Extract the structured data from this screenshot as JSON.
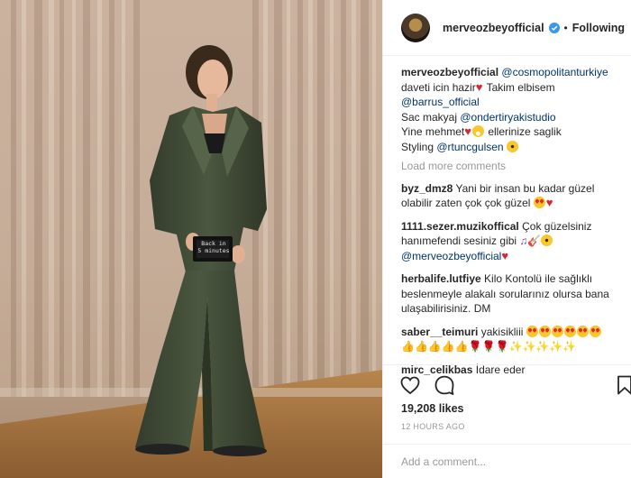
{
  "post": {
    "sign_text": "Back in\n5 minutes"
  },
  "header": {
    "username": "merveozbeyofficial",
    "dot": "•",
    "follow_label": "Following"
  },
  "caption": {
    "username": "merveozbeyofficial",
    "mention_cosmo": "@cosmopolitanturkiye",
    "line1": "daveti icin hazir",
    "line1b": "Takim elbisem",
    "mention_barrus": "@barrus_official",
    "line3": "Sac makyaj ",
    "mention_onder": "@ondertiryakistudio",
    "line4a": "Yine mehmet",
    "line4b": " ellerinize saglik",
    "line5": "Styling ",
    "mention_rtunc": "@rtuncgulsen"
  },
  "load_more": "Load more comments",
  "comments": [
    {
      "user": "byz_dmz8",
      "text": "Yani bir insan bu kadar güzel olabilir zaten çok çok güzel"
    },
    {
      "user": "1111.sezer.muzikoffical",
      "text": "Çok güzelsiniz hanımefendi sesiniz gibi",
      "mention": "@merveozbeyofficial"
    },
    {
      "user": "herbalife.lutfiye",
      "text": "Kilo Kontolü ile sağlıklı beslenmeyle alakalı sorularınız olursa bana ulaşabilirisiniz. DM"
    },
    {
      "user": "saber__teimuri",
      "text": "yakisikliii"
    },
    {
      "user": "mirc_celikbas",
      "text": "İdare eder"
    }
  ],
  "likes": "19,208 likes",
  "timestamp": "12 HOURS AGO",
  "add_comment_placeholder": "Add a comment...",
  "icons": {
    "like": "heart-outline-icon",
    "comment": "speech-bubble-icon",
    "save": "bookmark-icon",
    "verified": "verified-badge-icon"
  },
  "colors": {
    "mention": "#003569",
    "muted": "#999999",
    "verified": "#3897f0",
    "suit": "#3f4a36"
  }
}
